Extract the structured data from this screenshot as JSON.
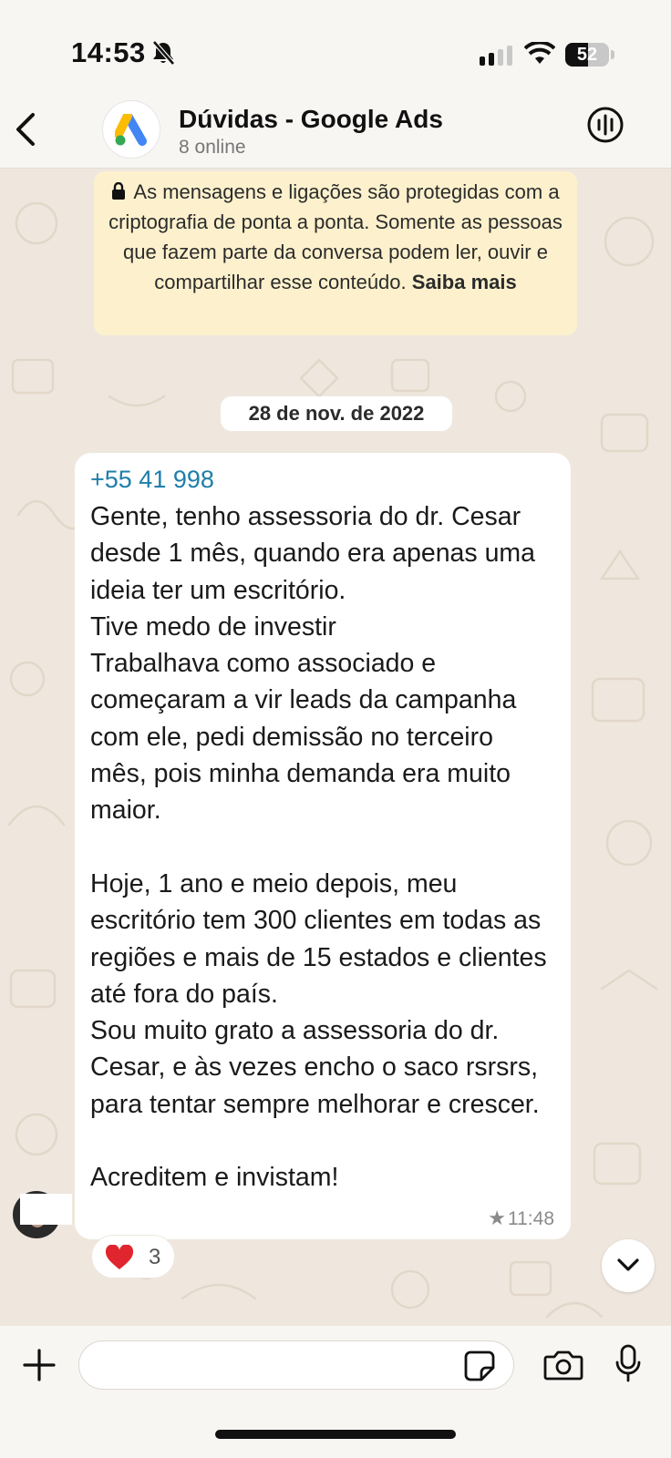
{
  "status_bar": {
    "time": "14:53",
    "battery_level": "52",
    "battery_fraction": 0.52
  },
  "header": {
    "title": "Dúvidas - Google Ads",
    "subtitle": "8 online"
  },
  "notice": {
    "text": "As mensagens e ligações são protegidas com a criptografia de ponta a ponta. Somente as pessoas que fazem parte da conversa podem ler, ouvir e compartilhar esse conteúdo.",
    "link": "Saiba mais"
  },
  "date_divider": "28 de nov. de 2022",
  "message": {
    "sender": "+55 41 998",
    "text": "Gente, tenho assessoria do dr. Cesar desde 1 mês, quando era apenas uma ideia ter um escritório.\nTive medo de investir\nTrabalhava como associado e começaram a vir leads da campanha com ele, pedi demissão no terceiro mês, pois minha demanda era muito maior.\n\nHoje, 1 ano e meio depois, meu escritório tem 300 clientes em todas as regiões e mais de 15 estados e clientes até fora do país.\nSou muito grato a assessoria do dr. Cesar, e às vezes encho o saco rsrsrs, para tentar sempre melhorar e crescer.\n\nAcreditem e invistam!",
    "time": "11:48",
    "starred_icon": "★",
    "reaction_emoji": "heart",
    "reaction_count": "3"
  },
  "composer": {
    "placeholder": ""
  },
  "icons": {
    "back": "chevron-left-icon",
    "call": "group-call-icon",
    "plus": "plus-icon",
    "sticker": "sticker-icon",
    "camera": "camera-icon",
    "mic": "microphone-icon",
    "scroll_down": "chevron-down-icon"
  },
  "colors": {
    "sender_name": "#1d7ea9",
    "notice_bg": "#fdf1cd",
    "chat_bg": "#efe7de",
    "heart": "#e0252f"
  }
}
